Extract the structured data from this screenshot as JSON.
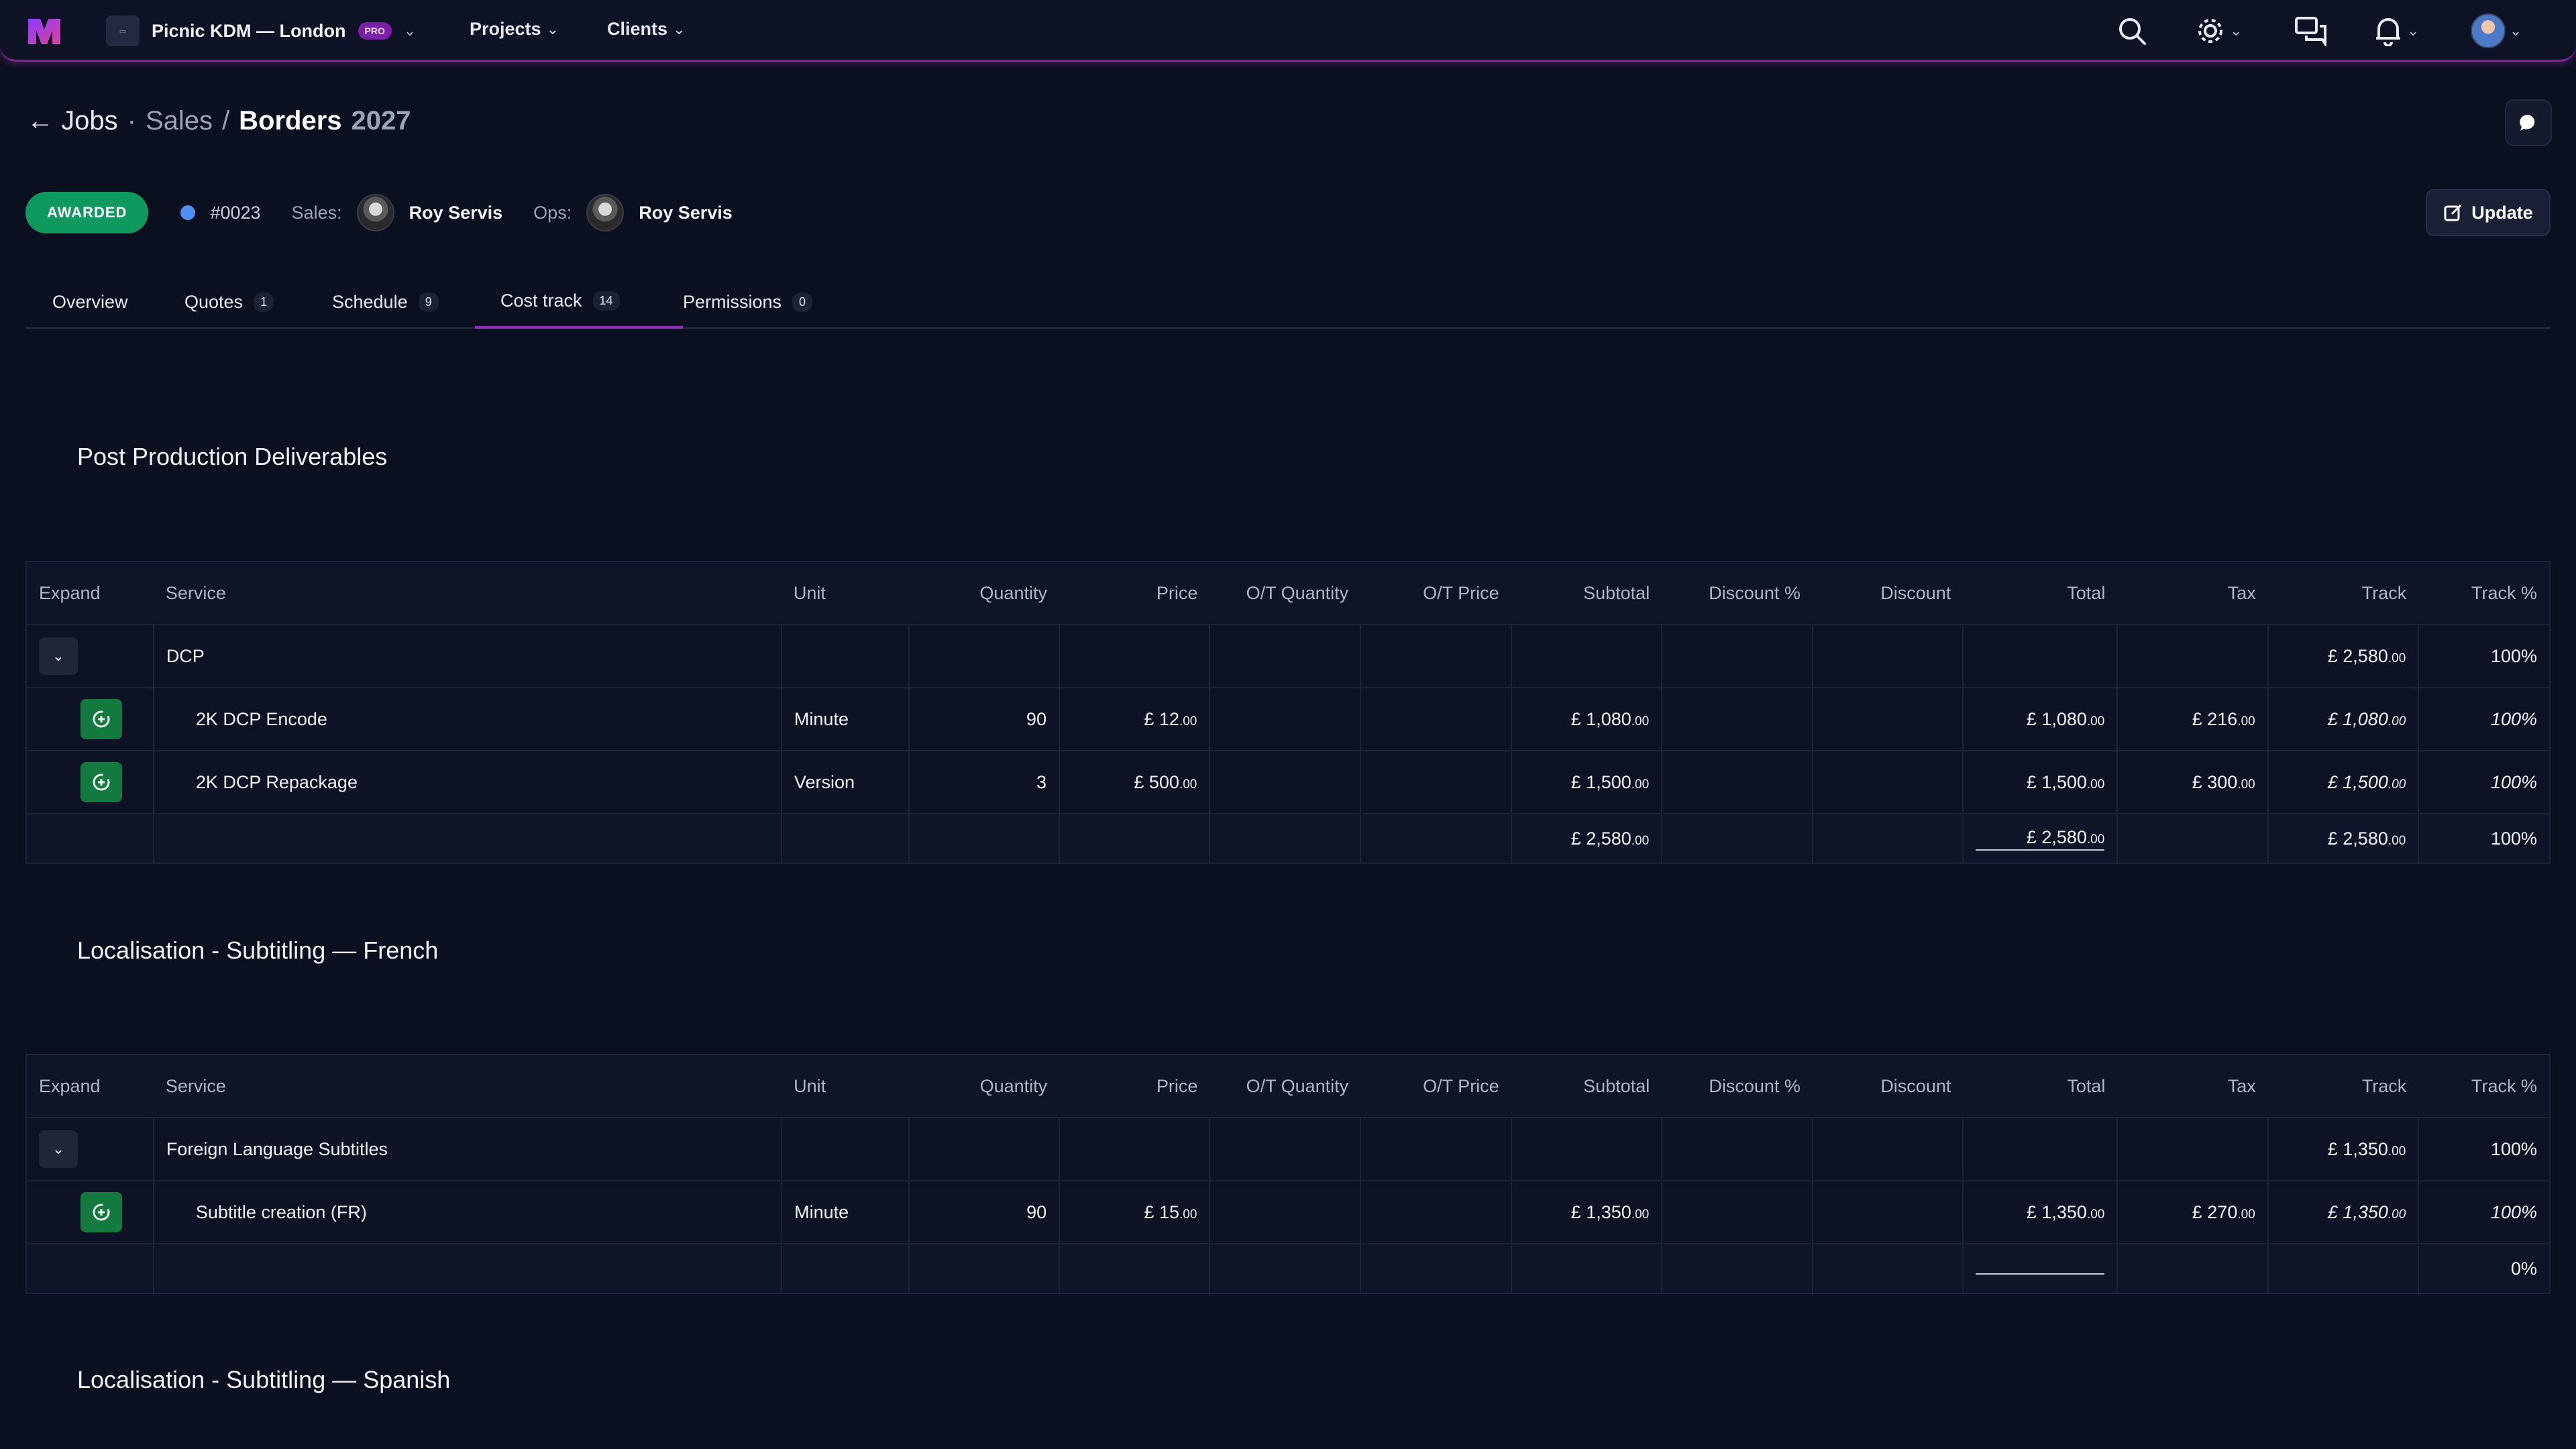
{
  "topnav": {
    "org_name": "Picnic KDM — London",
    "org_badge": "PRO",
    "projects_label": "Projects",
    "clients_label": "Clients",
    "icons": [
      "logo-icon",
      "search-icon",
      "gear-icon",
      "messages-icon",
      "bell-icon",
      "user-avatar"
    ],
    "accent_color": "#9b2ac4"
  },
  "breadcrumb": {
    "back": "Jobs",
    "sep1": "·",
    "section": "Sales",
    "sep2": "/",
    "title": "Borders",
    "year": "2027"
  },
  "meta": {
    "status": "AWARDED",
    "status_color": "#0e9a5e",
    "job_number": "#0023",
    "sales_label": "Sales:",
    "sales_person": "Roy Servis",
    "ops_label": "Ops:",
    "ops_person": "Roy Servis",
    "update_label": "Update"
  },
  "tabs": [
    {
      "label": "Overview",
      "count": ""
    },
    {
      "label": "Quotes",
      "count": "1"
    },
    {
      "label": "Schedule",
      "count": "9"
    },
    {
      "label": "Cost track",
      "count": "14",
      "active": true
    },
    {
      "label": "Permissions",
      "count": "0"
    }
  ],
  "columns": [
    "Expand",
    "Service",
    "Unit",
    "Quantity",
    "Price",
    "O/T Quantity",
    "O/T Price",
    "Subtotal",
    "Discount %",
    "Discount",
    "Total",
    "Tax",
    "Track",
    "Track %"
  ],
  "sections": [
    {
      "title": "Post Production Deliverables",
      "group": {
        "name": "DCP",
        "track": "£ 2,580",
        "track_cents": ".00",
        "track_pct": "100%"
      },
      "rows": [
        {
          "service": "2K DCP Encode",
          "unit": "Minute",
          "quantity": "90",
          "price": "£ 12",
          "price_cents": ".00",
          "subtotal": "£ 1,080",
          "subtotal_cents": ".00",
          "total": "£ 1,080",
          "total_cents": ".00",
          "tax": "£ 216",
          "tax_cents": ".00",
          "track": "£ 1,080",
          "track_cents": ".00",
          "track_pct": "100%"
        },
        {
          "service": "2K DCP Repackage",
          "unit": "Version",
          "quantity": "3",
          "price": "£ 500",
          "price_cents": ".00",
          "subtotal": "£ 1,500",
          "subtotal_cents": ".00",
          "total": "£ 1,500",
          "total_cents": ".00",
          "tax": "£ 300",
          "tax_cents": ".00",
          "track": "£ 1,500",
          "track_cents": ".00",
          "track_pct": "100%"
        }
      ],
      "totals": {
        "subtotal": "£ 2,580",
        "subtotal_cents": ".00",
        "total": "£ 2,580",
        "total_cents": ".00",
        "track": "£ 2,580",
        "track_cents": ".00",
        "track_pct": "100%"
      }
    },
    {
      "title": "Localisation - Subtitling — French",
      "group": {
        "name": "Foreign Language Subtitles",
        "track": "£ 1,350",
        "track_cents": ".00",
        "track_pct": "100%"
      },
      "rows": [
        {
          "service": "Subtitle creation (FR)",
          "unit": "Minute",
          "quantity": "90",
          "price": "£ 15",
          "price_cents": ".00",
          "subtotal": "£ 1,350",
          "subtotal_cents": ".00",
          "total": "£ 1,350",
          "total_cents": ".00",
          "tax": "£ 270",
          "tax_cents": ".00",
          "track": "£ 1,350",
          "track_cents": ".00",
          "track_pct": "100%"
        }
      ],
      "totals": {
        "track_pct": "0%"
      }
    },
    {
      "title": "Localisation - Subtitling — Spanish"
    }
  ]
}
